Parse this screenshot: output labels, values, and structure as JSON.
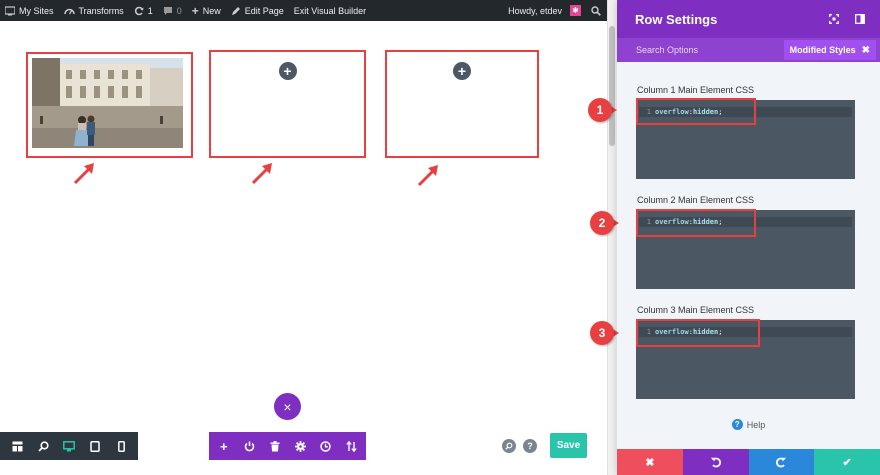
{
  "adminbar": {
    "my_sites": "My Sites",
    "site_name": "Transforms",
    "updates_count": "1",
    "comments_count": "0",
    "new_label": "New",
    "edit_page": "Edit Page",
    "exit_builder": "Exit Visual Builder",
    "howdy": "Howdy, etdev"
  },
  "panel": {
    "title": "Row Settings",
    "tab_search": "Search Options",
    "tab_modified": "Modified Styles",
    "sections": [
      {
        "label": "Column 1 Main Element CSS",
        "line_no": "1",
        "property": "overflow",
        "value": "hidden",
        "badge": "1"
      },
      {
        "label": "Column 2 Main Element CSS",
        "line_no": "1",
        "property": "overflow",
        "value": "hidden",
        "badge": "2"
      },
      {
        "label": "Column 3 Main Element CSS",
        "line_no": "1",
        "property": "overflow",
        "value": "hidden",
        "badge": "3"
      }
    ],
    "help": "Help"
  },
  "toolbar": {
    "save_label": "Save",
    "close_glyph": "×",
    "add_glyph": "+"
  },
  "colors": {
    "purple": "#7e2ec0",
    "teal": "#29c4a9",
    "highlight": "#e84040",
    "footer_red": "#ef4f5d",
    "footer_purple": "#7e2ec0",
    "footer_blue": "#2b87da",
    "footer_green": "#29c4a9"
  }
}
